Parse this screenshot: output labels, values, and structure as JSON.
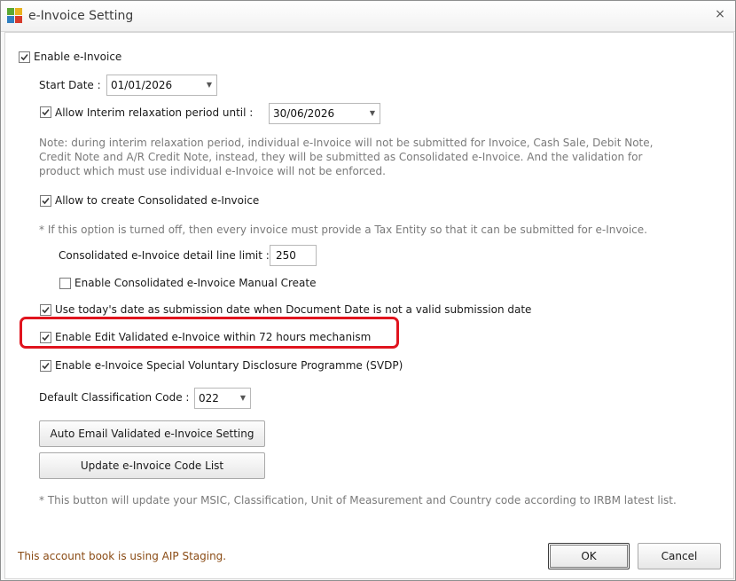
{
  "window": {
    "title": "e-Invoice Setting",
    "close_glyph": "×"
  },
  "settings": {
    "enable_einvoice": {
      "label": "Enable e-Invoice",
      "checked": true
    },
    "start_date": {
      "label": "Start Date :",
      "value": "01/01/2026"
    },
    "interim": {
      "label": "Allow Interim relaxation period until :",
      "checked": true,
      "value": "30/06/2026"
    },
    "interim_note": [
      "Note: during interim relaxation period, individual e-Invoice will not be submitted for Invoice, Cash Sale, Debit Note,",
      "Credit Note and A/R Credit Note, instead, they will be submitted as Consolidated e-Invoice. And the validation for",
      "product which must use individual e-Invoice will not be enforced."
    ],
    "allow_consolidated": {
      "label": "Allow to create Consolidated e-Invoice",
      "checked": true
    },
    "consolidated_note": "* If this option is turned off, then every invoice must provide a Tax Entity so that it can be submitted for e-Invoice.",
    "detail_line_limit": {
      "label": "Consolidated e-Invoice detail line limit :",
      "value": "250"
    },
    "manual_create": {
      "label": "Enable Consolidated e-Invoice Manual Create",
      "checked": false
    },
    "todays_date": {
      "label": "Use today's date as submission date when Document Date is not a valid submission date",
      "checked": true
    },
    "edit_validated": {
      "label": "Enable Edit Validated e-Invoice within 72 hours mechanism",
      "checked": true
    },
    "svdp": {
      "label": "Enable e-Invoice Special Voluntary Disclosure Programme (SVDP)",
      "checked": true
    },
    "classification_code": {
      "label": "Default Classification Code :",
      "value": "022"
    }
  },
  "buttons": {
    "auto_email": "Auto Email Validated e-Invoice Setting",
    "update_code_list": "Update e-Invoice Code List",
    "ok": "OK",
    "cancel": "Cancel"
  },
  "update_note": "* This button will update your MSIC, Classification, Unit of Measurement and Country code according to IRBM latest list.",
  "footer": "This account book is using AIP Staging.",
  "colors": {
    "highlight": "#e0141e",
    "note_text": "#7a7a7a",
    "footer_text": "#8a4b14"
  },
  "icons": {
    "app": "einvoice-app-icon",
    "dropdown": "chevron-down-icon",
    "check": "checkmark-icon"
  }
}
